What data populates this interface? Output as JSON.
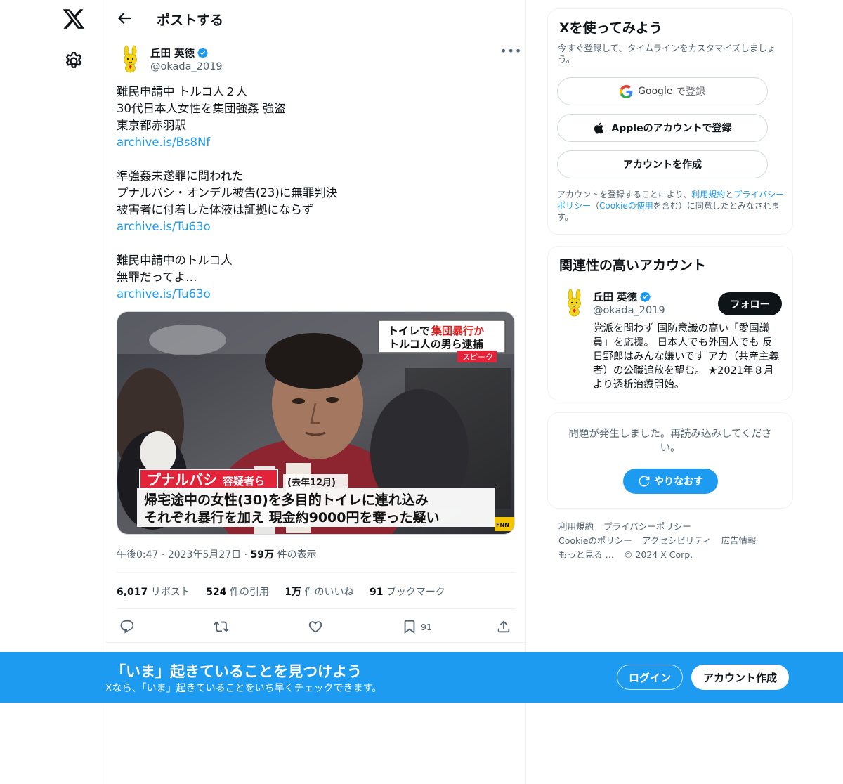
{
  "header": {
    "title": "ポストする"
  },
  "tweet": {
    "author_name": "丘田 英徳",
    "author_handle": "@okada_2019",
    "lines": [
      "難民申請中 トルコ人２人",
      "30代日本人女性を集団強姦 強盗",
      "東京都赤羽駅",
      "archive.is/Bs8Nf",
      "",
      "準強姦未遂罪に問われた",
      "プナルバシ・オンデル被告(23)に無罪判決",
      "被害者に付着した体液は証拠にならず",
      "archive.is/Tu63o",
      "",
      "難民申請中のトルコ人",
      "無罪だってよ…",
      "archive.is/Tu63o"
    ],
    "media": {
      "caption_top_line1_a": "トイレで",
      "caption_top_line1_b": "集団暴行か",
      "caption_top_line2": "トルコ人の男ら逮捕",
      "caption_speak": "スピーク",
      "caption_name_a": "プナルバシ",
      "caption_name_b": "容疑者ら",
      "caption_date": "(去年12月)",
      "caption_bottom_line1": "帰宅途中の女性(30)を多目的トイレに連れ込み",
      "caption_bottom_line2": "それぞれ暴行を加え 現金約9000円を奪った疑い",
      "logo": "FNN"
    },
    "time": "午後0:47",
    "date": "2023年5月27日",
    "views_count": "59万",
    "views_label": "件の表示",
    "stats": {
      "reposts_count": "6,017",
      "reposts_label": "リポスト",
      "quotes_count": "524",
      "quotes_label": "件の引用",
      "likes_count": "1万",
      "likes_label": "件のいいね",
      "bookmarks_count": "91",
      "bookmarks_label": "ブックマーク"
    },
    "bookmark_action_count": "91"
  },
  "signup_card": {
    "title": "Xを使ってみよう",
    "subtitle": "今すぐ登録して、タイムラインをカスタマイズしましょう。",
    "google_brand": "Google",
    "google_label": "で登録",
    "apple_label": "Appleのアカウントで登録",
    "create_label": "アカウントを作成",
    "legal_prefix": "アカウントを登録することにより、",
    "legal_terms": "利用規約",
    "legal_and": "と",
    "legal_privacy": "プライバシーポリシー",
    "legal_paren_open": "（",
    "legal_cookie": "Cookieの使用",
    "legal_suffix": "を含む）に同意したとみなされます。"
  },
  "related_card": {
    "title": "関連性の高いアカウント",
    "name": "丘田 英徳",
    "handle": "@okada_2019",
    "follow_label": "フォロー",
    "bio": "党派を問わず 国防意識の高い「愛国議員」を応援。 日本人でも外国人でも 反日野郎はみんな嫌いです アカ（共産主義者）の公職追放を望む。 ★2021年８月より透析治療開始。"
  },
  "error_card": {
    "message": "問題が発生しました。再読み込みしてください。",
    "retry_label": "やりなおす"
  },
  "footer": {
    "links": [
      "利用規約",
      "プライバシーポリシー",
      "Cookieのポリシー",
      "アクセシビリティ",
      "広告情報",
      "もっと見る …"
    ],
    "copyright": "© 2024 X Corp."
  },
  "banner": {
    "title": "「いま」起きていることを見つけよう",
    "subtitle": "Xなら、「いま」起きていることをいち早くチェックできます。",
    "login_label": "ログイン",
    "signup_label": "アカウント作成"
  },
  "colors": {
    "accent": "#1d9bf0",
    "text": "#0f1419",
    "muted": "#536471",
    "border": "#eff3f4"
  }
}
